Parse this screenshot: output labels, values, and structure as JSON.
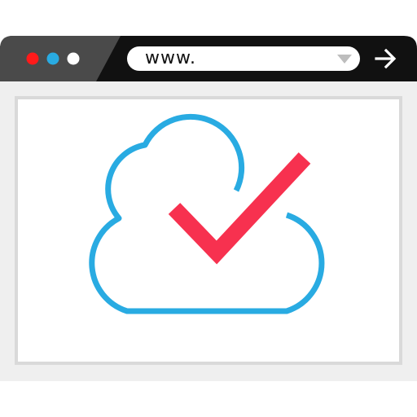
{
  "address_bar": {
    "url": "www."
  },
  "window_controls": [
    "close-dot",
    "minimize-dot",
    "maximize-dot"
  ],
  "icons": {
    "dropdown": "triangle-down-icon",
    "go": "arrow-right-icon",
    "cloud": "cloud-icon",
    "check": "checkmark-icon"
  },
  "colors": {
    "titlebar": "#111111",
    "titlebar_accent": "#4a4a4a",
    "close": "#ff1a1a",
    "minimize": "#29abe2",
    "maximize": "#ffffff",
    "page_bg": "#efefef",
    "content_border": "#d9d9d9",
    "cloud": "#29abe2",
    "check": "#f7314f"
  }
}
